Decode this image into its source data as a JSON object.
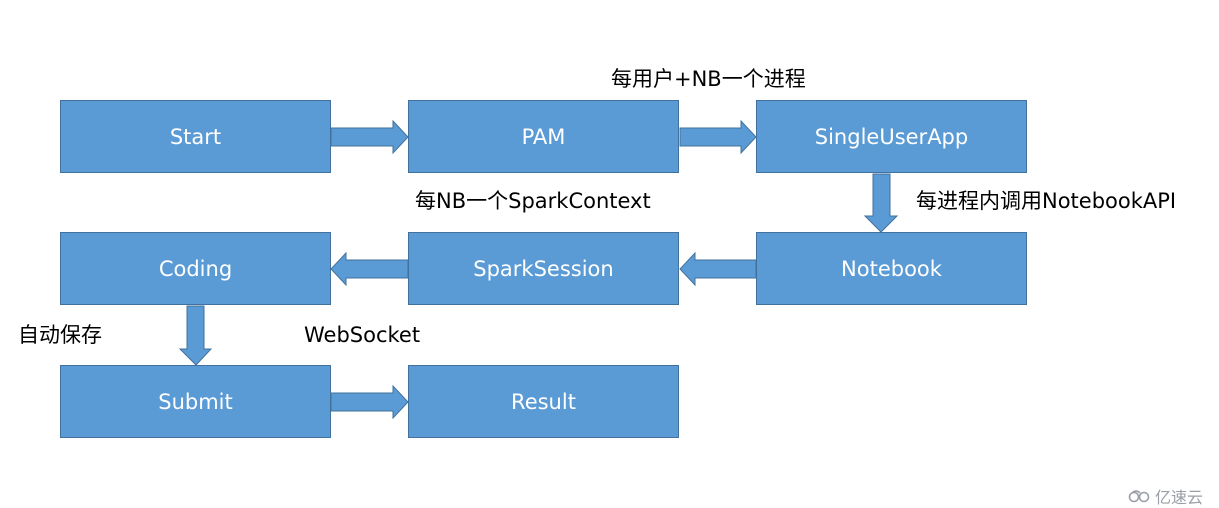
{
  "nodes": {
    "start": "Start",
    "pam": "PAM",
    "single_user_app": "SingleUserApp",
    "coding": "Coding",
    "spark_session": "SparkSession",
    "notebook": "Notebook",
    "submit": "Submit",
    "result": "Result"
  },
  "edge_labels": {
    "per_user_nb_process": "每用户+NB一个进程",
    "per_nb_spark_context": "每NB一个SparkContext",
    "per_process_notebook_api": "每进程内调用NotebookAPI",
    "auto_save": "自动保存",
    "websocket": "WebSocket"
  },
  "edges": [
    {
      "from": "start",
      "to": "pam"
    },
    {
      "from": "pam",
      "to": "single_user_app"
    },
    {
      "from": "single_user_app",
      "to": "notebook"
    },
    {
      "from": "notebook",
      "to": "spark_session"
    },
    {
      "from": "spark_session",
      "to": "coding"
    },
    {
      "from": "coding",
      "to": "submit"
    },
    {
      "from": "submit",
      "to": "result"
    }
  ],
  "colors": {
    "node_fill": "#5B9BD5",
    "node_border": "#41719C",
    "node_text": "#FFFFFF"
  },
  "watermark": {
    "icon": "cloud-logo-icon",
    "text": "亿速云"
  }
}
